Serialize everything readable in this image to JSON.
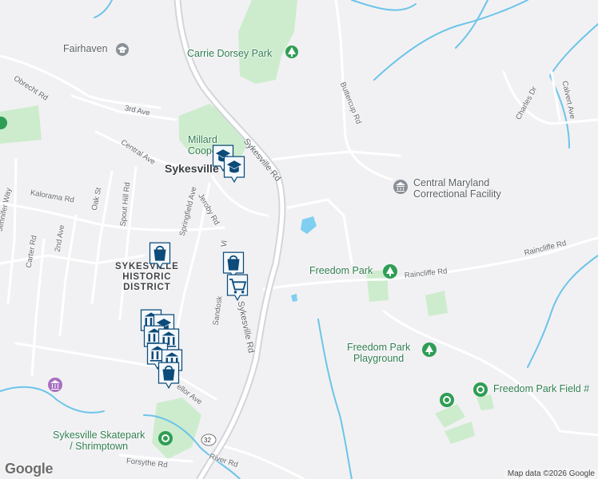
{
  "map": {
    "colors": {
      "land": "#f1f1f3",
      "road": "#ffffff",
      "highway": "#cfd3d8",
      "park": "#cdeccd",
      "water": "#7fcff0",
      "stream": "#6cc4ea",
      "marker": "#0c4b7a"
    },
    "places": {
      "fairhaven": "Fairhaven",
      "carrie_dorsey_park": "Carrie Dorsey Park",
      "millard_cooper": "Millard\nCooper",
      "sykesville": "Sykesville",
      "central_maryland": "Central Maryland\nCorrectional Facility",
      "freedom_park": "Freedom Park",
      "freedom_park_playground": "Freedom Park\nPlayground",
      "freedom_park_field": "Freedom Park Field #",
      "sykesville_historic_district": "SYKESVILLE\nHISTORIC\nDISTRICT",
      "skatepark": "Sykesville Skatepark\n/ Shrimptown"
    },
    "roads": {
      "obrecht_rd": "Obrecht Rd",
      "third_ave": "3rd Ave",
      "central_ave": "Central Ave",
      "sykesville_rd_north": "Sykesville Rd",
      "sykesville_rd_south": "Sykesville Rd",
      "buttercup_rd": "Buttercup Rd",
      "charles_dr": "Charles Dr",
      "calvert_ave": "Calvert Ave",
      "jennifer_way": "Jennifer Way",
      "kalorama_rd": "Kalorama Rd",
      "oak_st": "Oak St",
      "spout_hill_rd": "Spout Hill Rd",
      "springfield_ave": "Springfield Ave",
      "jeroby_rd": "Jeroby Rd",
      "carter_rd": "Carter Rd",
      "second_ave": "2nd Ave",
      "raincliffe_rd": "Raincliffe Rd",
      "raincliffe_rd_east": "Raincliffe Rd",
      "sandosky": "Sandosk",
      "vi": "Vi",
      "ellor_ave": "ellor Ave",
      "forsythe_rd": "Forsythe Rd",
      "river_rd": "River Rd",
      "route_32": "32"
    },
    "branding": {
      "logo": "Google",
      "attribution": "Map data ©2026 Google"
    }
  }
}
